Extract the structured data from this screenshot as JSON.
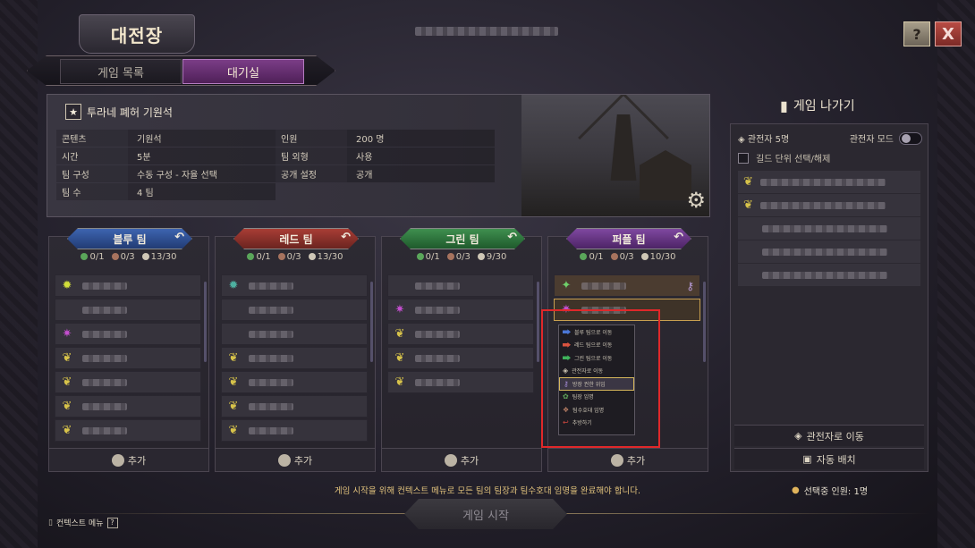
{
  "window": {
    "title": "대전장",
    "help_icon": "?",
    "close_icon": "X"
  },
  "tabs": [
    {
      "label": "게임 목록",
      "active": false
    },
    {
      "label": "대기실",
      "active": true
    }
  ],
  "info": {
    "title": "투라네 폐허 기원석",
    "rows": [
      {
        "k1": "콘텐츠",
        "v1": "기원석",
        "k2": "인원",
        "v2": "200 명"
      },
      {
        "k1": "시간",
        "v1": "5분",
        "k2": "팀 외형",
        "v2": "사용"
      },
      {
        "k1": "팀 구성",
        "v1": "수동 구성 - 자율 선택",
        "k2": "공개 설정",
        "v2": "공개"
      },
      {
        "k1": "팀 수",
        "v1": "4 팀",
        "k2": "",
        "v2": ""
      }
    ]
  },
  "teams": [
    {
      "name": "블루 팀",
      "leader": "0/1",
      "guard": "0/3",
      "people": "13/30",
      "add_label": "추가",
      "color": "#2c4c8d"
    },
    {
      "name": "레드 팀",
      "leader": "0/1",
      "guard": "0/3",
      "people": "13/30",
      "add_label": "추가",
      "color": "#8b2f2a"
    },
    {
      "name": "그린 팀",
      "leader": "0/1",
      "guard": "0/3",
      "people": "9/30",
      "add_label": "추가",
      "color": "#2d6e3b"
    },
    {
      "name": "퍼플 팀",
      "leader": "0/1",
      "guard": "0/3",
      "people": "10/30",
      "add_label": "추가",
      "color": "#6a2f84"
    }
  ],
  "context_menu": {
    "items": [
      {
        "label": "블루 팀으로 이동",
        "color": "#4b77d6"
      },
      {
        "label": "레드 팀으로 이동",
        "color": "#d9533f"
      },
      {
        "label": "그린 팀으로 이동",
        "color": "#3fb35b"
      },
      {
        "label": "관전자로 이동",
        "color": "#c9c1b0"
      },
      {
        "label": "방장 권한 위임",
        "color": "#a28ad3",
        "selected": true
      },
      {
        "label": "팀장 임명",
        "color": "#5ea35a"
      },
      {
        "label": "팀수호대 임명",
        "color": "#b37b62"
      },
      {
        "label": "추방하기",
        "color": "#d0483f"
      }
    ]
  },
  "spectator": {
    "exit_label": "게임 나가기",
    "count_label": "관전자  5명",
    "mode_label": "관전자 모드",
    "guild_label": "길드 단위 선택/해제",
    "move_label": "관전자로 이동",
    "auto_label": "자동 배치"
  },
  "footer": {
    "notice": "게임 시작을 위해 컨텍스트 메뉴로 모든 팀의 팀장과 팀수호대 임명을 완료해야 합니다.",
    "start_label": "게임 시작",
    "selected_count": "선택중 인원: 1명",
    "context_menu_label": "컨텍스트 메뉴",
    "context_menu_help": "?"
  }
}
